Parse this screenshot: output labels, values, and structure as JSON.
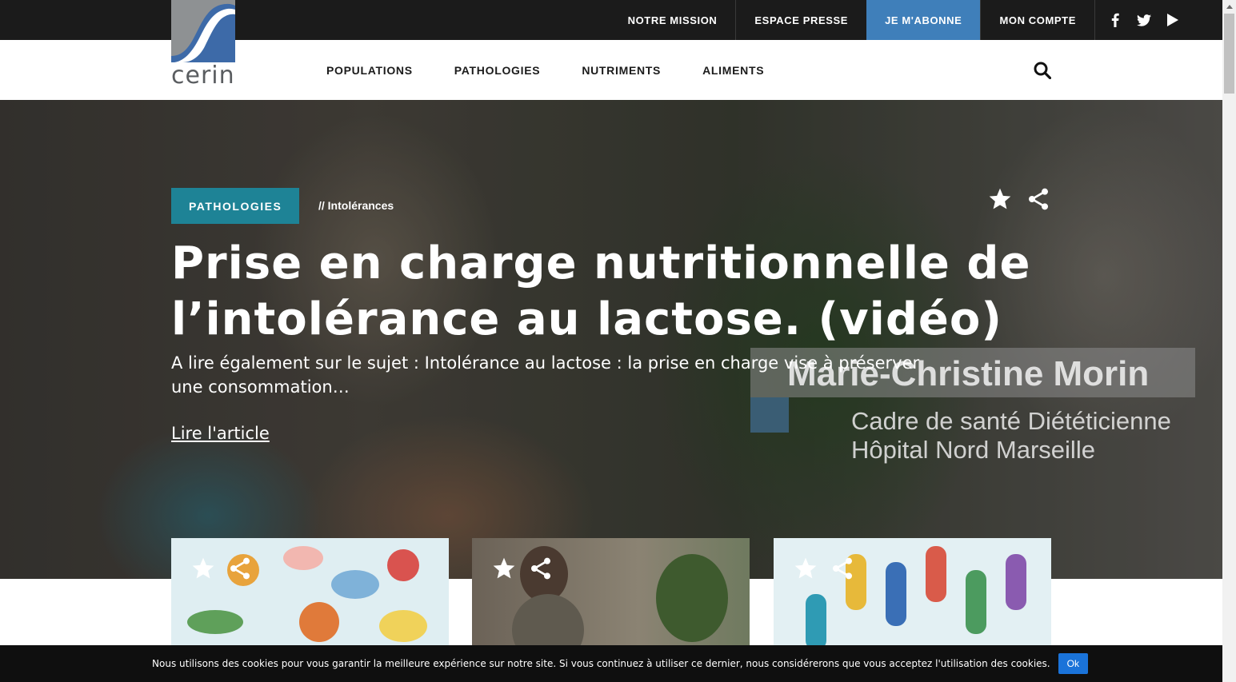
{
  "brand": {
    "logo_text": "cerin",
    "color_blue": "#3f7fba",
    "color_teal": "#1e8396"
  },
  "topbar": {
    "links": [
      "NOTRE MISSION",
      "ESPACE PRESSE",
      "JE M'ABONNE",
      "MON COMPTE"
    ],
    "social_icons": [
      "facebook-icon",
      "twitter-icon",
      "youtube-icon"
    ]
  },
  "nav": {
    "items": [
      "POPULATIONS",
      "PATHOLOGIES",
      "NUTRIMENTS",
      "ALIMENTS"
    ],
    "search_icon": "search-icon"
  },
  "hero": {
    "category": "PATHOLOGIES",
    "subcategory": "// Intolérances",
    "title": "Prise en charge nutritionnelle de l’intolérance au lactose. (vidéo)",
    "excerpt": "A lire également sur le sujet : Intolérance au lactose : la prise en charge vise à préserver une consommation…",
    "link": "Lire l'article",
    "video_overlay_name": "Marie-Christine Morin",
    "video_overlay_role_1": "Cadre de santé Diététicienne",
    "video_overlay_role_2": "Hôpital Nord Marseille",
    "action_icons": [
      "star-icon",
      "share-icon"
    ]
  },
  "cards": [
    {
      "image": "food-illustration",
      "icons": [
        "star-icon",
        "share-icon"
      ]
    },
    {
      "image": "interview-video-still",
      "icons": [
        "star-icon",
        "share-icon"
      ]
    },
    {
      "image": "people-illustration",
      "icons": [
        "star-icon",
        "share-icon"
      ]
    }
  ],
  "cookie": {
    "text": "Nous utilisons des cookies pour vous garantir la meilleure expérience sur notre site. Si vous continuez à utiliser ce dernier, nous considérerons que vous acceptez l'utilisation des cookies.",
    "button": "Ok"
  }
}
